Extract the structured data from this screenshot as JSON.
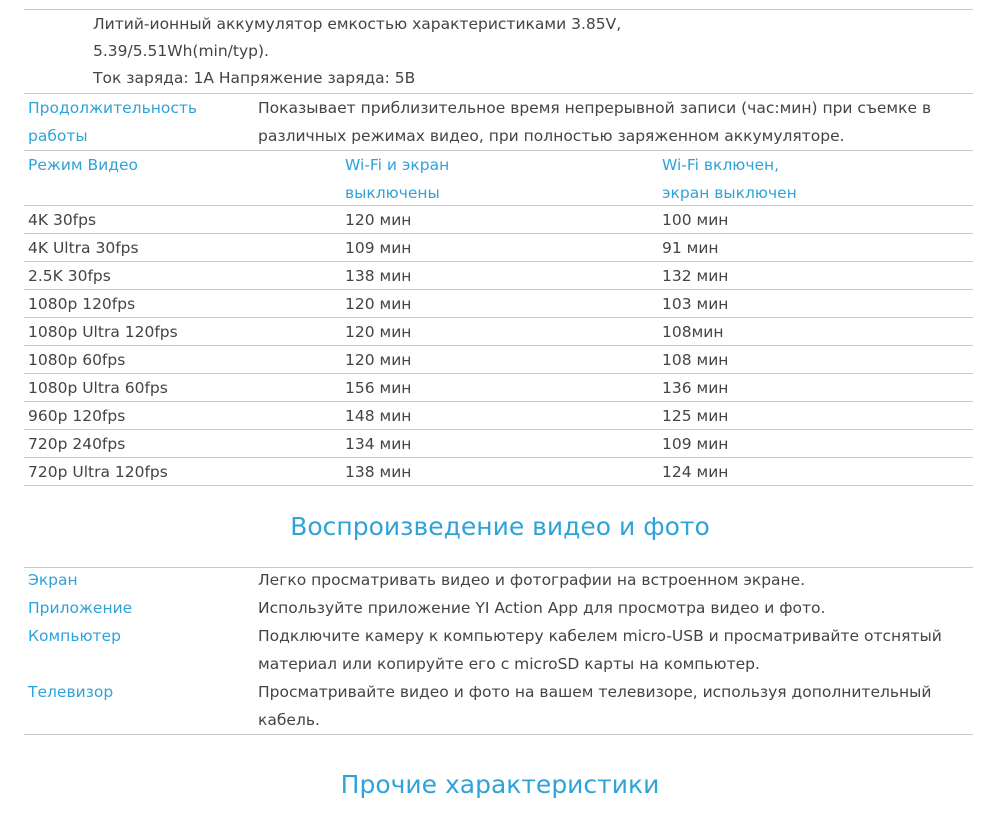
{
  "battery": {
    "lines": [
      "Литий-ионный аккумулятор емкостью характеристиками 3.85V,",
      "5.39/5.51Wh(min/typ).",
      "Ток заряда: 1A Напряжение заряда: 5B"
    ]
  },
  "duration": {
    "label_lines": [
      "Продолжительность",
      "работы"
    ],
    "desc_lines": [
      "Показывает приблизительное время непрерывной записи (час:мин) при съемке в",
      "различных режимах видео, при полностью заряженном аккумуляторе."
    ]
  },
  "table": {
    "col_mode": "Режим Видео",
    "col_off_lines": [
      "Wi-Fi и экран",
      "выключены"
    ],
    "col_on_lines": [
      "Wi-Fi включен,",
      "экран выключен"
    ],
    "rows": [
      {
        "mode": "4K 30fps",
        "off": "120 мин",
        "on": "100 мин"
      },
      {
        "mode": "4K Ultra 30fps",
        "off": "109 мин",
        "on": "91 мин"
      },
      {
        "mode": "2.5K 30fps",
        "off": "138 мин",
        "on": "132 мин"
      },
      {
        "mode": "1080p 120fps",
        "off": "120 мин",
        "on": "103 мин"
      },
      {
        "mode": "1080p Ultra 120fps",
        "off": "120 мин",
        "on": "108мин"
      },
      {
        "mode": "1080p 60fps",
        "off": "120 мин",
        "on": "108 мин"
      },
      {
        "mode": "1080p Ultra 60fps",
        "off": "156 мин",
        "on": "136 мин"
      },
      {
        "mode": "960p 120fps",
        "off": "148 мин",
        "on": "125 мин"
      },
      {
        "mode": "720p 240fps",
        "off": "134 мин",
        "on": "109 мин"
      },
      {
        "mode": "720p Ultra 120fps",
        "off": "138 мин",
        "on": "124 мин"
      }
    ]
  },
  "playback": {
    "heading": "Воспроизведение видео и фото",
    "items": [
      {
        "label": "Экран",
        "desc_lines": [
          "Легко просматривать видео и фотографии на встроенном экране."
        ]
      },
      {
        "label": "Приложение",
        "desc_lines": [
          "Используйте приложение YI Action App для просмотра видео и фото."
        ]
      },
      {
        "label": "Компьютер",
        "desc_lines": [
          "Подключите камеру к компьютеру кабелем micro-USB и просматривайте отснятый",
          "материал или копируйте его с microSD карты на компьютер."
        ]
      },
      {
        "label": "Телевизор",
        "desc_lines": [
          "Просматривайте видео и фото на вашем телевизоре, используя дополнительный",
          "кабель."
        ]
      }
    ]
  },
  "other": {
    "heading": "Прочие  характеристики"
  },
  "colors": {
    "accent": "#2fa3d9",
    "text": "#444444",
    "rule": "#c8c8c8"
  }
}
